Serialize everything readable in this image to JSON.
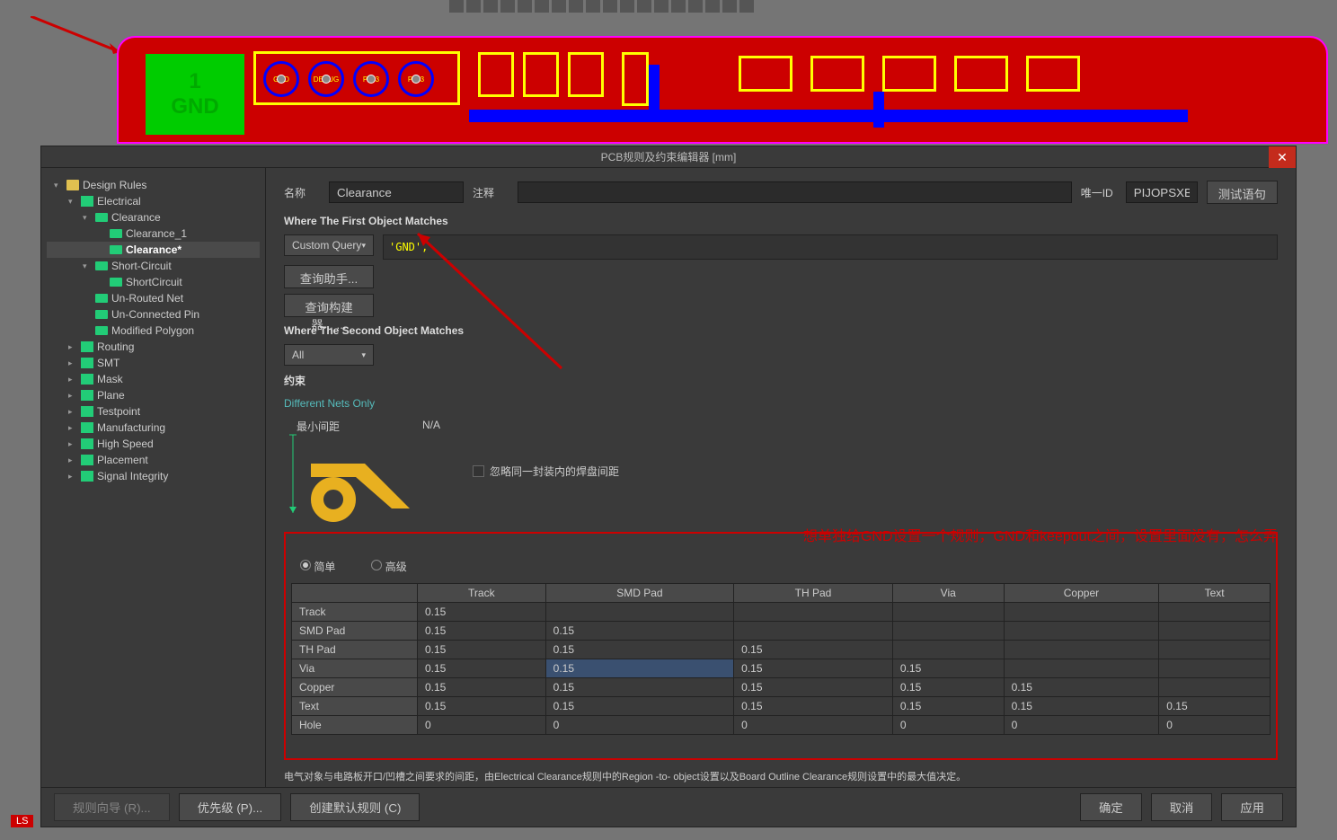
{
  "toolbar_icons": [
    "t1",
    "t2",
    "t3",
    "t4",
    "t5",
    "t6",
    "t7",
    "t8",
    "t9",
    "t10",
    "t11",
    "t12",
    "t13",
    "t14",
    "t15",
    "t16",
    "t17",
    "t18"
  ],
  "pcb": {
    "gnd_num": "1",
    "gnd_label": "GND",
    "pins": [
      "GND",
      "DEBUG",
      "PIO3",
      "PIO3"
    ]
  },
  "dialog": {
    "title": "PCB规则及约束编辑器 [mm]"
  },
  "tree": [
    {
      "d": 0,
      "e": "▾",
      "i": "folder",
      "t": "Design Rules"
    },
    {
      "d": 1,
      "e": "▾",
      "i": "elec",
      "t": "Electrical"
    },
    {
      "d": 2,
      "e": "▾",
      "i": "rule",
      "t": "Clearance"
    },
    {
      "d": 3,
      "e": "",
      "i": "rule",
      "t": "Clearance_1"
    },
    {
      "d": 3,
      "e": "",
      "i": "rule",
      "t": "Clearance*",
      "sel": true
    },
    {
      "d": 2,
      "e": "▾",
      "i": "rule",
      "t": "Short-Circuit"
    },
    {
      "d": 3,
      "e": "",
      "i": "rule",
      "t": "ShortCircuit"
    },
    {
      "d": 2,
      "e": "",
      "i": "rule",
      "t": "Un-Routed Net"
    },
    {
      "d": 2,
      "e": "",
      "i": "rule",
      "t": "Un-Connected Pin"
    },
    {
      "d": 2,
      "e": "",
      "i": "rule",
      "t": "Modified Polygon"
    },
    {
      "d": 1,
      "e": "▸",
      "i": "elec",
      "t": "Routing"
    },
    {
      "d": 1,
      "e": "▸",
      "i": "elec",
      "t": "SMT"
    },
    {
      "d": 1,
      "e": "▸",
      "i": "elec",
      "t": "Mask"
    },
    {
      "d": 1,
      "e": "▸",
      "i": "elec",
      "t": "Plane"
    },
    {
      "d": 1,
      "e": "▸",
      "i": "elec",
      "t": "Testpoint"
    },
    {
      "d": 1,
      "e": "▸",
      "i": "elec",
      "t": "Manufacturing"
    },
    {
      "d": 1,
      "e": "▸",
      "i": "elec",
      "t": "High Speed"
    },
    {
      "d": 1,
      "e": "▸",
      "i": "elec",
      "t": "Placement"
    },
    {
      "d": 1,
      "e": "▸",
      "i": "elec",
      "t": "Signal Integrity"
    }
  ],
  "form": {
    "name_label": "名称",
    "name_value": "Clearance",
    "comment_label": "注释",
    "comment_value": "",
    "id_label": "唯一ID",
    "id_value": "PIJOPSXB",
    "test_btn": "测试语句"
  },
  "match1": {
    "header": "Where The First Object Matches",
    "mode": "Custom Query",
    "query": "'GND',",
    "helper_btn": "查询助手... ...",
    "builder_btn": "查询构建器... ..."
  },
  "match2": {
    "header": "Where The Second Object Matches",
    "mode": "All"
  },
  "constraint": {
    "header": "约束",
    "diff_nets": "Different Nets Only",
    "min_label": "最小间距",
    "na": "N/A",
    "ignore_label": "忽略同一封装内的焊盘间距",
    "annotation": "想单独给GND设置一个规则，GND和keepout之间，设置里面没有，怎么弄",
    "mode_simple": "简单",
    "mode_adv": "高级"
  },
  "table": {
    "cols": [
      "",
      "Track",
      "SMD Pad",
      "TH Pad",
      "Via",
      "Copper",
      "Text"
    ],
    "rows": [
      {
        "h": "Track",
        "v": [
          "0.15",
          "",
          "",
          "",
          "",
          ""
        ]
      },
      {
        "h": "SMD Pad",
        "v": [
          "0.15",
          "0.15",
          "",
          "",
          "",
          ""
        ]
      },
      {
        "h": "TH Pad",
        "v": [
          "0.15",
          "0.15",
          "0.15",
          "",
          "",
          ""
        ]
      },
      {
        "h": "Via",
        "v": [
          "0.15",
          "0.15",
          "0.15",
          "0.15",
          "",
          ""
        ],
        "sel": 1
      },
      {
        "h": "Copper",
        "v": [
          "0.15",
          "0.15",
          "0.15",
          "0.15",
          "0.15",
          ""
        ]
      },
      {
        "h": "Text",
        "v": [
          "0.15",
          "0.15",
          "0.15",
          "0.15",
          "0.15",
          "0.15"
        ]
      },
      {
        "h": "Hole",
        "v": [
          "0",
          "0",
          "0",
          "0",
          "0",
          "0"
        ]
      }
    ]
  },
  "footnote": "电气对象与电路板开口/凹槽之间要求的间距，由Electrical Clearance规则中的Region -to- object设置以及Board Outline Clearance规则设置中的最大值决定。",
  "footer": {
    "wizard": "规则向导 (R)...",
    "priority": "优先级 (P)...",
    "defaults": "创建默认规则 (C)",
    "ok": "确定",
    "cancel": "取消",
    "apply": "应用"
  },
  "ls": "LS"
}
